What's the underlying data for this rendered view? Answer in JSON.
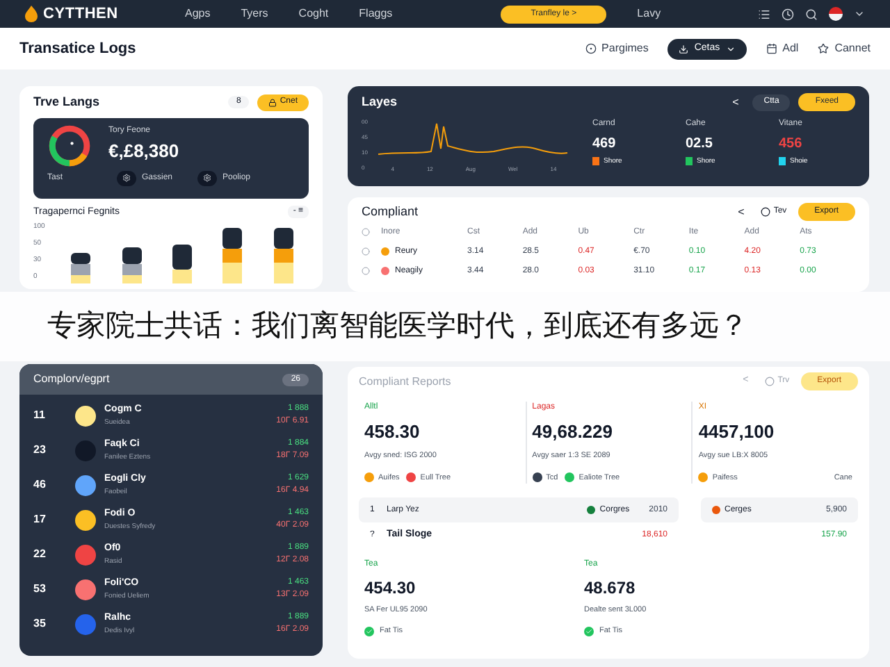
{
  "nav": {
    "brand": "CYTTHEN",
    "links": [
      "Agps",
      "Tyers",
      "Coght",
      "Flaggs"
    ],
    "cta": "Tranfley le >",
    "user": "Lavy"
  },
  "header": {
    "title": "Transatice Logs",
    "actions": [
      {
        "kind": "link",
        "label": "Pargimes"
      },
      {
        "kind": "dropdown",
        "label": "Cetas"
      },
      {
        "kind": "link",
        "label": "Adl"
      },
      {
        "kind": "link",
        "label": "Cannet"
      }
    ]
  },
  "summary": {
    "title": "Trve Langs",
    "count": "8",
    "button": "Cnet",
    "label": "Tory Feone",
    "value": "€,£8,380",
    "footer": [
      "Tast",
      "Gassien",
      "Pooliop"
    ]
  },
  "bars": {
    "title": "Tragapernci Fegnits",
    "menu": "- ≡",
    "y_labels": [
      "100",
      "50",
      "30",
      "0"
    ]
  },
  "trend": {
    "title": "Layes",
    "back": "<",
    "pill": "Ctta",
    "button": "Fxeed",
    "y_labels": [
      "00",
      "45",
      "10",
      "0"
    ],
    "x_labels": [
      "4",
      "12",
      "Aug",
      "Wel",
      "14"
    ],
    "stats": [
      {
        "label": "Carnd",
        "value": "469",
        "alert": false,
        "legend": "Shore",
        "color": "#f97316"
      },
      {
        "label": "Cahe",
        "value": "02.5",
        "alert": false,
        "legend": "Shore",
        "color": "#22c55e"
      },
      {
        "label": "Vitane",
        "value": "456",
        "alert": true,
        "legend": "Shoie",
        "color": "#22d3ee"
      }
    ]
  },
  "compliant": {
    "title": "Compliant",
    "back": "<",
    "radio": "Tev",
    "button": "Export",
    "columns": [
      {
        "label": "Inore"
      },
      {
        "label": "Cst",
        "kind": "neutral"
      },
      {
        "label": "Add",
        "kind": "neutral"
      },
      {
        "label": "Ub",
        "kind": "negative"
      },
      {
        "label": "Ctr",
        "kind": "neutral"
      },
      {
        "label": "Ite",
        "kind": "positive"
      },
      {
        "label": "Add",
        "kind": "negative"
      },
      {
        "label": "Ats",
        "kind": "positive"
      }
    ],
    "rows": [
      {
        "color": "#f59e0b",
        "cells": [
          "Reury",
          "3.14",
          "28.5",
          "0.47",
          "€.70",
          "0.10",
          "4.20",
          "0.73"
        ]
      },
      {
        "color": "#f87171",
        "cells": [
          "Neagily",
          "3.44",
          "28.0",
          "0.03",
          "31.10",
          "0.17",
          "0.13",
          "0.00"
        ]
      }
    ]
  },
  "caption": "专家院士共话：我们离智能医学时代，到底还有多远？",
  "ranking": {
    "title": "Complorv/egprt",
    "badge": "26",
    "rows": [
      {
        "rank": "11",
        "name": "Cogm C",
        "sub": "Sueidea",
        "value": "1 888",
        "change": "10Γ 6.91",
        "color": "#fde68a"
      },
      {
        "rank": "23",
        "name": "Faqk Ci",
        "sub": "Fanilee Eztens",
        "value": "1 884",
        "change": "18Γ 7.09",
        "color": "#111827"
      },
      {
        "rank": "46",
        "name": "Eogli Cly",
        "sub": "Faobeil",
        "value": "1 629",
        "change": "16Γ 4.94",
        "color": "#60a5fa"
      },
      {
        "rank": "17",
        "name": "Fodi O",
        "sub": "Duestes Syfredy",
        "value": "1 463",
        "change": "40Γ 2.09",
        "color": "#fbbf24"
      },
      {
        "rank": "22",
        "name": "Of0",
        "sub": "Rasid",
        "value": "1 889",
        "change": "12Γ 2.08",
        "color": "#ef4444"
      },
      {
        "rank": "53",
        "name": "Foli'CO",
        "sub": "Fonied Ueliem",
        "value": "1 463",
        "change": "13Γ 2.09",
        "color": "#f87171"
      },
      {
        "rank": "35",
        "name": "Ralhc",
        "sub": "Dedis Ivyl",
        "value": "1 889",
        "change": "16Γ 2.09",
        "color": "#2563eb"
      }
    ]
  },
  "reports": {
    "title": "Compliant Reports",
    "back": "<",
    "radio": "Trv",
    "button": "Export",
    "stats": [
      {
        "label": "Alltl",
        "kind": "positive",
        "value": "458.30",
        "sub": "Avgy sned: ISG 2000",
        "legend": [
          {
            "color": "#f59e0b",
            "label": "Auifes"
          },
          {
            "color": "#ef4444",
            "label": "Eull Tree"
          }
        ]
      },
      {
        "label": "Lagas",
        "kind": "negative",
        "value": "49,68.229",
        "sub": "Avgy saer 1:3 SE 2089",
        "legend": [
          {
            "color": "#374151",
            "label": "Tcd"
          },
          {
            "color": "#22c55e",
            "label": "Ealiote Tree"
          }
        ]
      },
      {
        "label": "XI",
        "kind": "warning",
        "value": "4457,100",
        "sub": "Avgy sue LB:X 8005",
        "legend": [
          {
            "color": "#f59e0b",
            "label": "Paifess"
          },
          {
            "label": "Cane"
          }
        ]
      }
    ],
    "left_rows": [
      {
        "index": "1",
        "label": "Larp Yez",
        "tag": "Corgres",
        "color": "#15803d",
        "value": "2010",
        "kind": "neutral"
      },
      {
        "index": "?",
        "label": "Tail Sloge",
        "value": "18,610",
        "kind": "negative"
      }
    ],
    "right_rows": [
      {
        "tag": "Cerges",
        "color": "#ea580c",
        "value": "5,900",
        "kind": "neutral"
      },
      {
        "value": "157.90",
        "kind": "positive"
      }
    ],
    "totals": [
      {
        "label": "Tea",
        "value": "454.30",
        "sub": "SA Fer UL95 2090",
        "tag": "Fat Tis"
      },
      {
        "label": "Tea",
        "value": "48.678",
        "sub": "Dealte sent 3L000",
        "tag": "Fat Tis"
      }
    ]
  }
}
